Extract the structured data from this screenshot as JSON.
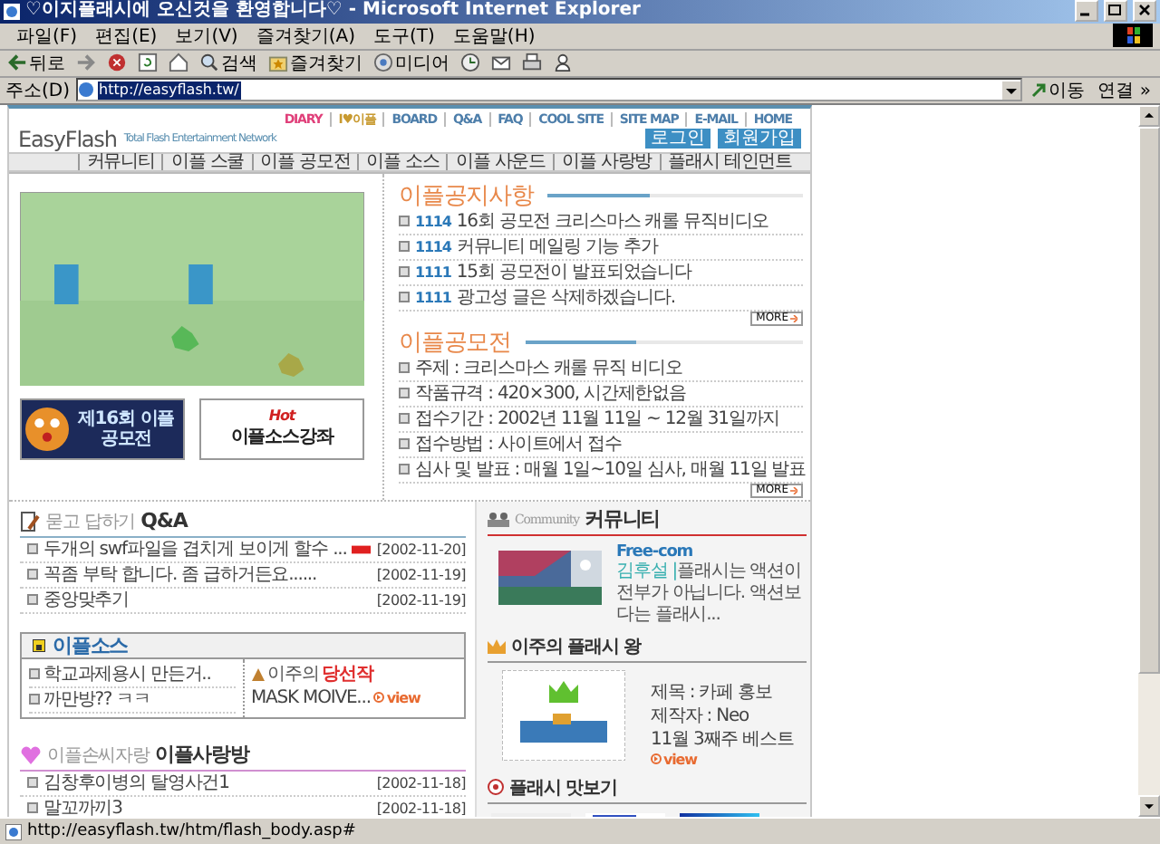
{
  "window": {
    "title": "♡이지플래시에 오신것을 환영합니다♡ - Microsoft Internet Explorer"
  },
  "menu": [
    "파일(F)",
    "편집(E)",
    "보기(V)",
    "즐겨찾기(A)",
    "도구(T)",
    "도움말(H)"
  ],
  "toolbar": [
    {
      "kind": "back",
      "label": "뒤로"
    },
    {
      "kind": "forward"
    },
    {
      "kind": "stop"
    },
    {
      "kind": "refresh"
    },
    {
      "kind": "home"
    },
    {
      "kind": "search",
      "label": "검색"
    },
    {
      "kind": "favorites",
      "label": "즐겨찾기"
    },
    {
      "kind": "media",
      "label": "미디어"
    },
    {
      "kind": "history"
    },
    {
      "kind": "mail"
    },
    {
      "kind": "print"
    },
    {
      "kind": "messenger"
    }
  ],
  "address": {
    "label": "주소(D)",
    "value": "http://easyflash.tw/",
    "go": "이동",
    "links": "연결 »"
  },
  "site": {
    "top_links": [
      {
        "label": "DIARY",
        "color": "#e0407a"
      },
      {
        "label": "I♥이플",
        "color": "#c89a30"
      },
      {
        "label": "BOARD",
        "color": "#4d7eaa"
      },
      {
        "label": "Q&A",
        "color": "#4d7eaa"
      },
      {
        "label": "FAQ",
        "color": "#4d7eaa"
      },
      {
        "label": "COOL SITE",
        "color": "#4d7eaa"
      },
      {
        "label": "SITE MAP",
        "color": "#4d7eaa"
      },
      {
        "label": "E-MAIL",
        "color": "#4d7eaa"
      },
      {
        "label": "HOME",
        "color": "#4d7eaa"
      }
    ],
    "logo": "EasyFlash",
    "tagline": "Total Flash Entertainment Network",
    "account_buttons": [
      "로그인",
      "회원가입"
    ],
    "nav": [
      "커뮤니티",
      "이플 스쿨",
      "이플 공모전",
      "이플 소스",
      "이플 사운드",
      "이플 사랑방",
      "플래시 테인먼트"
    ],
    "banners": [
      {
        "kind": "contest",
        "text": "제16회 이플 공모전"
      },
      {
        "kind": "lecture",
        "text": "이플소스강좌",
        "badge": "Hot"
      }
    ],
    "notices": {
      "title": "이플공지사항",
      "items": [
        {
          "number": "1114",
          "text": "16회 공모전 크리스마스 캐롤 뮤직비디오"
        },
        {
          "number": "1114",
          "text": "커뮤니티 메일링 기능 추가"
        },
        {
          "number": "1111",
          "text": "15회 공모전이 발표되었습니다"
        },
        {
          "number": "1111",
          "text": "광고성 글은 삭제하겠습니다."
        }
      ],
      "more": "MORE"
    },
    "contest": {
      "title": "이플공모전",
      "items": [
        "주제 : 크리스마스 캐롤 뮤직 비디오",
        "작품규격 : 420×300, 시간제한없음",
        "접수기간 : 2002년 11월 11일 ~ 12월 31일까지",
        "접수방법 : 사이트에서 접수",
        "심사 및 발표 : 매월 1일~10일 심사, 매월 11일 발표"
      ],
      "more": "MORE"
    },
    "qa": {
      "subtitle": "묻고 답하기",
      "title": "Q&A",
      "rows": [
        {
          "title": "두개의 swf파일을 겹치게 보이게 할수 ...",
          "new": true,
          "date": "[2002-11-20]"
        },
        {
          "title": "꼭좀 부탁 합니다. 좀 급하거든요......",
          "new": false,
          "date": "[2002-11-19]"
        },
        {
          "title": "중앙맞추기",
          "new": false,
          "date": "[2002-11-19]"
        }
      ]
    },
    "source": {
      "title": "이플소스",
      "items": [
        "학교과제용시 만든거..",
        "까만방?? ㅋㅋ"
      ],
      "weekly_prefix": "이주의",
      "weekly_highlight": "당선작",
      "weekly_item": "MASK MOIVE...",
      "view": "view"
    },
    "sarangbang": {
      "subtitle": "이플손씨자랑",
      "title": "이플사랑방",
      "rows": [
        {
          "title": "김창후이병의 탈영사건1",
          "date": "[2002-11-18]"
        },
        {
          "title": "말꼬까끼3",
          "date": "[2002-11-18]"
        }
      ]
    },
    "community": {
      "subtitle": "Community",
      "title": "커뮤니티",
      "club": "Free-com",
      "author": "김후설 |",
      "text": "플래시는 액션이 전부가 아닙니다. 액션보다는 플래시..."
    },
    "weekly_flash": {
      "title": "이주의 플래시 왕",
      "lines": [
        "제목 : 카페 홍보",
        "제작자 : Neo",
        "11월 3째주 베스트"
      ],
      "view": "view"
    },
    "preview": {
      "title": "플래시 맛보기"
    }
  },
  "status_bar": "http://easyflash.tw/htm/flash_body.asp#"
}
